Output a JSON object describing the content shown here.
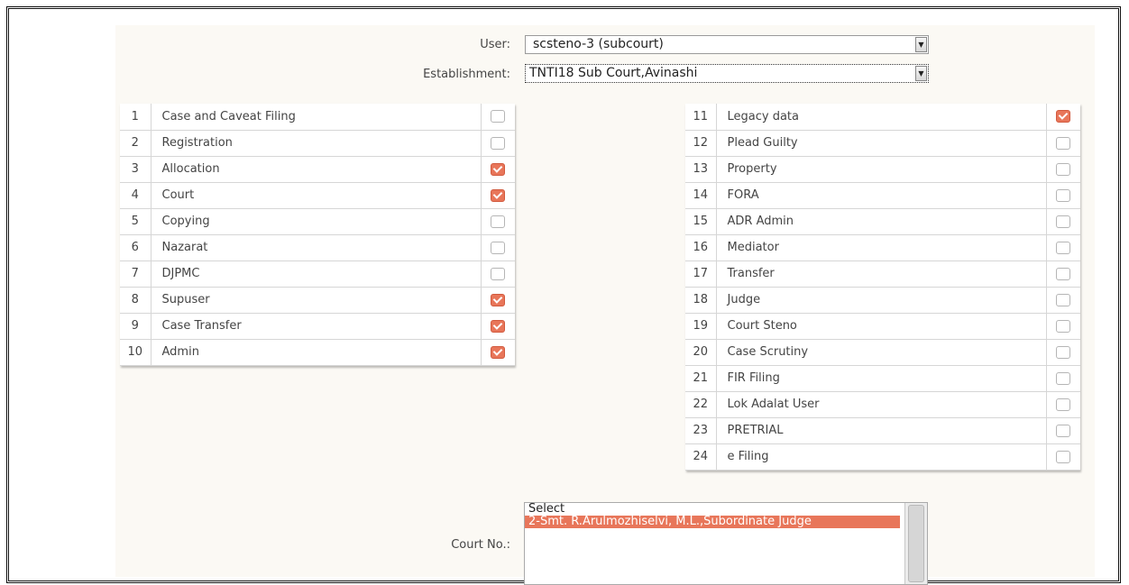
{
  "form": {
    "user_label": "User:",
    "user_value": "scsteno-3 (subcourt)",
    "establishment_label": "Establishment:",
    "establishment_value": "TNTI18 Sub Court,Avinashi",
    "court_label": "Court No.:"
  },
  "left_roles": [
    {
      "num": "1",
      "name": "Case and Caveat Filing",
      "checked": false
    },
    {
      "num": "2",
      "name": "Registration",
      "checked": false
    },
    {
      "num": "3",
      "name": "Allocation",
      "checked": true
    },
    {
      "num": "4",
      "name": "Court",
      "checked": true
    },
    {
      "num": "5",
      "name": "Copying",
      "checked": false
    },
    {
      "num": "6",
      "name": "Nazarat",
      "checked": false
    },
    {
      "num": "7",
      "name": "DJPMC",
      "checked": false
    },
    {
      "num": "8",
      "name": "Supuser",
      "checked": true
    },
    {
      "num": "9",
      "name": "Case Transfer",
      "checked": true
    },
    {
      "num": "10",
      "name": "Admin",
      "checked": true
    }
  ],
  "right_roles": [
    {
      "num": "11",
      "name": "Legacy data",
      "checked": true
    },
    {
      "num": "12",
      "name": "Plead Guilty",
      "checked": false
    },
    {
      "num": "13",
      "name": "Property",
      "checked": false
    },
    {
      "num": "14",
      "name": "FORA",
      "checked": false
    },
    {
      "num": "15",
      "name": "ADR Admin",
      "checked": false
    },
    {
      "num": "16",
      "name": "Mediator",
      "checked": false
    },
    {
      "num": "17",
      "name": "Transfer",
      "checked": false
    },
    {
      "num": "18",
      "name": "Judge",
      "checked": false
    },
    {
      "num": "19",
      "name": "Court Steno",
      "checked": false
    },
    {
      "num": "20",
      "name": "Case Scrutiny",
      "checked": false
    },
    {
      "num": "21",
      "name": "FIR Filing",
      "checked": false
    },
    {
      "num": "22",
      "name": "Lok Adalat User",
      "checked": false
    },
    {
      "num": "23",
      "name": "PRETRIAL",
      "checked": false
    },
    {
      "num": "24",
      "name": "e Filing",
      "checked": false
    }
  ],
  "court_list": {
    "options": [
      "Select",
      "2-Smt. R.Arulmozhiselvi, M.L.,Subordinate Judge"
    ],
    "selected_index": 1
  },
  "colors": {
    "accent": "#e8765a",
    "panel_bg": "#fbf9f4"
  }
}
